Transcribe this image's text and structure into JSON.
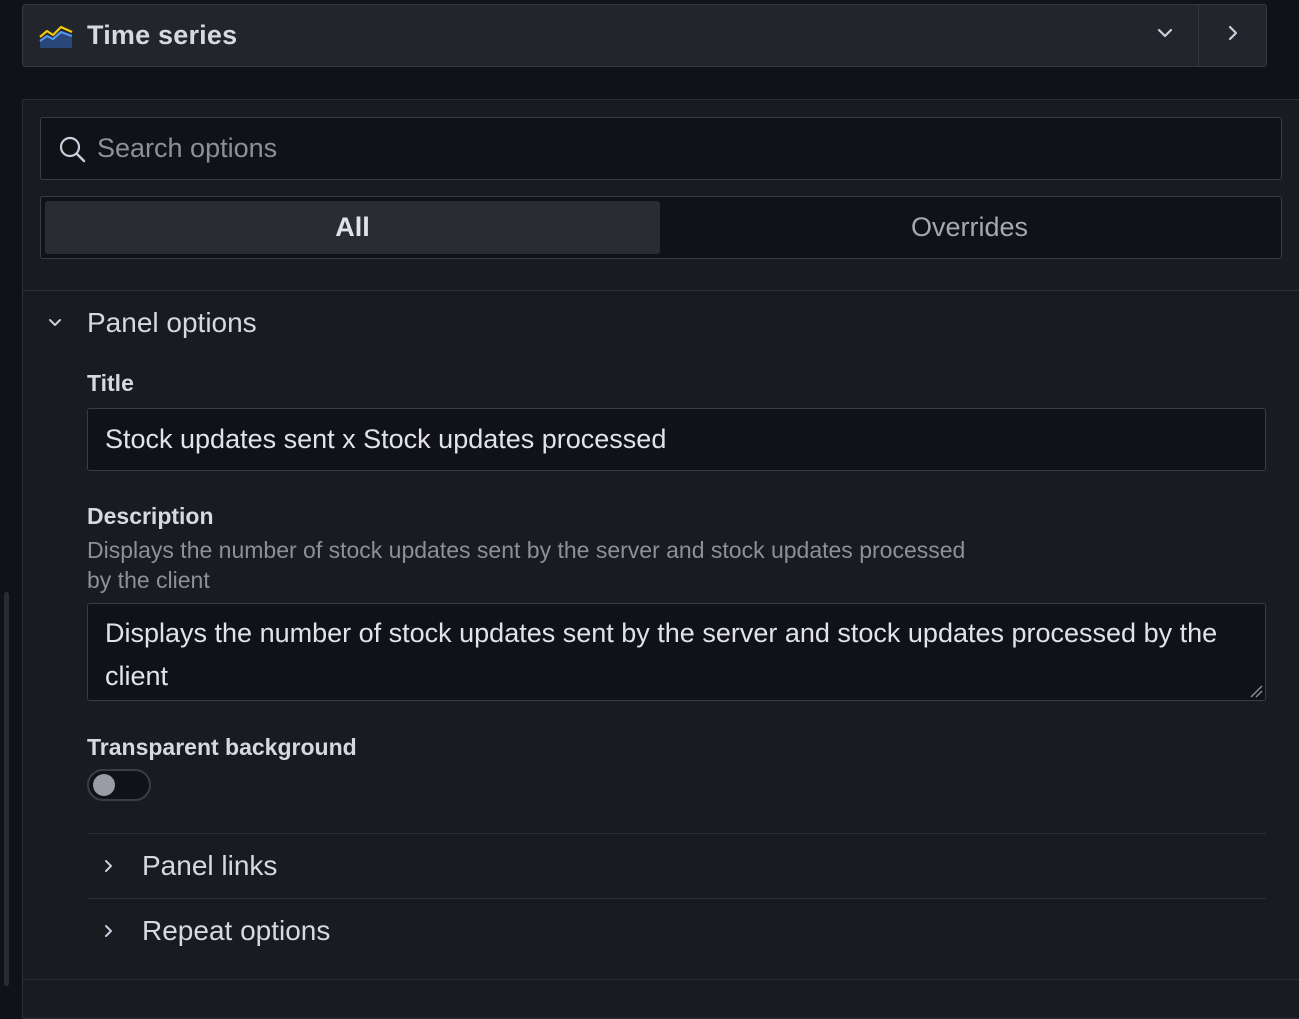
{
  "visualization": {
    "name": "Time series",
    "icon": "time-series-chart-icon"
  },
  "search": {
    "placeholder": "Search options",
    "value": ""
  },
  "tabs": [
    {
      "label": "All",
      "active": true
    },
    {
      "label": "Overrides",
      "active": false
    }
  ],
  "panel_options": {
    "section_title": "Panel options",
    "expanded": true,
    "title_field": {
      "label": "Title",
      "value": "Stock updates sent x Stock updates processed"
    },
    "description_field": {
      "label": "Description",
      "help_text": "Displays the number of stock updates sent by the server and stock updates processed by the client",
      "value": "Displays the number of stock updates sent by the server and stock updates processed by the client"
    },
    "transparent_background": {
      "label": "Transparent background",
      "enabled": false
    },
    "subsections": [
      {
        "label": "Panel links",
        "expanded": false
      },
      {
        "label": "Repeat options",
        "expanded": false
      }
    ]
  },
  "colors": {
    "background": "#111217",
    "panel": "#181b1f",
    "border": "#3a3d44",
    "text": "#d8d9e0",
    "muted": "#8e8f98"
  }
}
